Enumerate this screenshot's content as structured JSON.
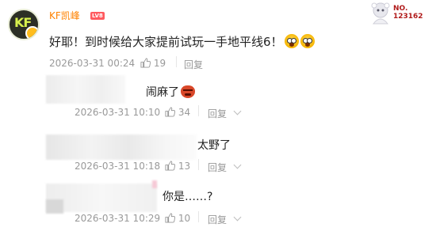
{
  "comment": {
    "username": "KF凯峰",
    "level_badge": "LV8",
    "text": "好耶！到时候给大家提前试玩一手地平线6！",
    "timestamp": "2026-03-31 00:24",
    "likes": "19",
    "reply_label": "回复"
  },
  "badge_card": {
    "no_label": "NO.",
    "number": "123162"
  },
  "replies": [
    {
      "text": "闹麻了",
      "timestamp": "2026-03-31 10:10",
      "likes": "34",
      "reply_label": "回复"
    },
    {
      "text": "太野了",
      "timestamp": "2026-03-31 10:18",
      "likes": "13",
      "reply_label": "回复"
    },
    {
      "text": "你是……?",
      "timestamp": "2026-03-31 10:29",
      "likes": "10",
      "reply_label": "回复"
    }
  ],
  "icons": {
    "thumbs_up": "thumbs-up-icon",
    "more": "chevron-down-icon",
    "emoji_scream": "emoji-scream-icon",
    "emoji_angry": "emoji-angry-icon"
  },
  "colors": {
    "username": "#ff8200",
    "level_badge": "#ff5a5f"
  }
}
